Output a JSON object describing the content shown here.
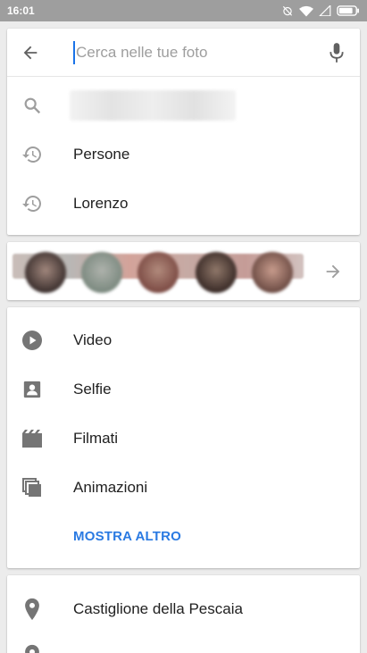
{
  "status_bar": {
    "time": "16:01"
  },
  "search": {
    "placeholder": "Cerca nelle tue foto",
    "value": ""
  },
  "recent_suggestions": [
    {
      "label": "Persone",
      "icon": "history-icon"
    },
    {
      "label": "Lorenzo",
      "icon": "history-icon"
    }
  ],
  "categories": [
    {
      "label": "Video",
      "icon": "play-circle-icon"
    },
    {
      "label": "Selfie",
      "icon": "portrait-icon"
    },
    {
      "label": "Filmati",
      "icon": "movie-icon"
    },
    {
      "label": "Animazioni",
      "icon": "layers-icon"
    }
  ],
  "show_more_label": "MOSTRA ALTRO",
  "places": [
    {
      "label": "Castiglione della Pescaia",
      "icon": "place-pin-icon"
    }
  ],
  "colors": {
    "accent": "#2a7ae2",
    "icon_gray": "#757575",
    "status_bar": "#9e9e9e"
  }
}
